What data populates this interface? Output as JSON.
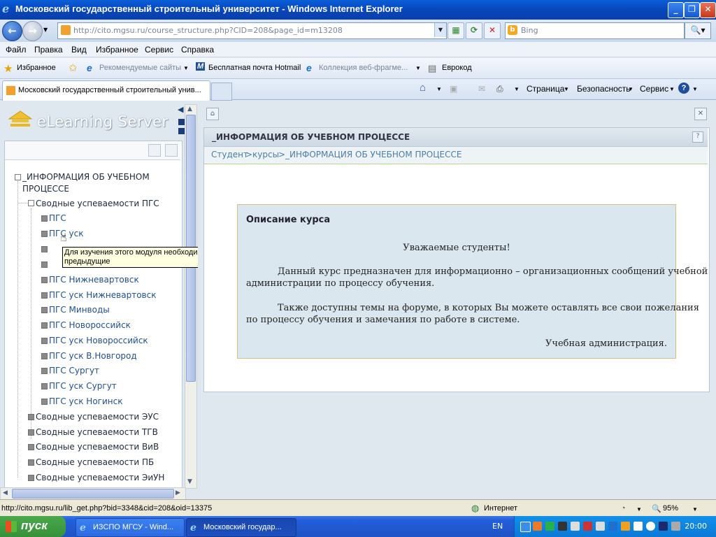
{
  "window": {
    "title": "Московский государственный строительный университет - Windows Internet Explorer"
  },
  "address": {
    "url": "http://cito.mgsu.ru/course_structure.php?CID=208&page_id=m13208",
    "search_placeholder": "Bing"
  },
  "menu": [
    "Файл",
    "Правка",
    "Вид",
    "Избранное",
    "Сервис",
    "Справка"
  ],
  "favorites": {
    "label": "Избранное",
    "items": [
      "Рекомендуемые сайты",
      "Бесплатная почта Hotmail",
      "Коллекция веб-фрагме...",
      "Еврокод"
    ]
  },
  "tabs": {
    "active": "Московский государственный строительный унив...",
    "commands": [
      "Страница",
      "Безопасность",
      "Сервис"
    ]
  },
  "left": {
    "logo": "eLearning Server",
    "tree": {
      "root_line1": "_ИНФОРМАЦИЯ ОБ УЧЕБНОМ",
      "root_line2": "ПРОЦЕССЕ",
      "group1": "Сводные успеваемости ПГС",
      "children": [
        "ПГС",
        "ПГС уск",
        "ПГС Нижневартовск",
        "ПГС уск Нижневартовск",
        "ПГС Минводы",
        "ПГС Новороссийск",
        "ПГС уск Новороссийск",
        "ПГС уск В.Новгород",
        "ПГС Сургут",
        "ПГС уск Сургут",
        "ПГС уск Ногинск"
      ],
      "groups": [
        "Сводные успеваемости ЭУС",
        "Сводные успеваемости ТГВ",
        "Сводные успеваемости ВиВ",
        "Сводные успеваемости ПБ",
        "Сводные успеваемости ЭиУН"
      ]
    },
    "tooltip": "Для изучения этого модуля необходимо пройти предыдущие"
  },
  "content": {
    "header": "_ИНФОРМАЦИЯ ОБ УЧЕБНОМ ПРОЦЕССЕ",
    "breadcrumb": [
      "Студент",
      ">",
      "курсы",
      ">",
      "_ИНФОРМАЦИЯ ОБ УЧЕБНОМ ПРОЦЕССЕ"
    ],
    "desc_title": "Описание курса",
    "greeting": "Уважаемые студенты!",
    "para1_l1": "Данный курс предназначен для информационно – организационных сообщений учебной",
    "para1_l2": "администрации по процессу обучения.",
    "para2_l1": "Также доступны темы на форуме, в которых Вы можете оставлять  все свои пожелания",
    "para2_l2": "по процессу обучения и замечания по работе в системе.",
    "signature": "Учебная администрация."
  },
  "status": {
    "url": "http://cito.mgsu.ru/lib_get.php?bid=3348&cid=208&oid=13375",
    "zone": "Интернет",
    "zoom": "95%"
  },
  "taskbar": {
    "start": "пуск",
    "tasks": [
      "ИЗСПО МГСУ - Wind...",
      "Московский государ..."
    ],
    "lang": "EN",
    "clock": "20:00"
  }
}
